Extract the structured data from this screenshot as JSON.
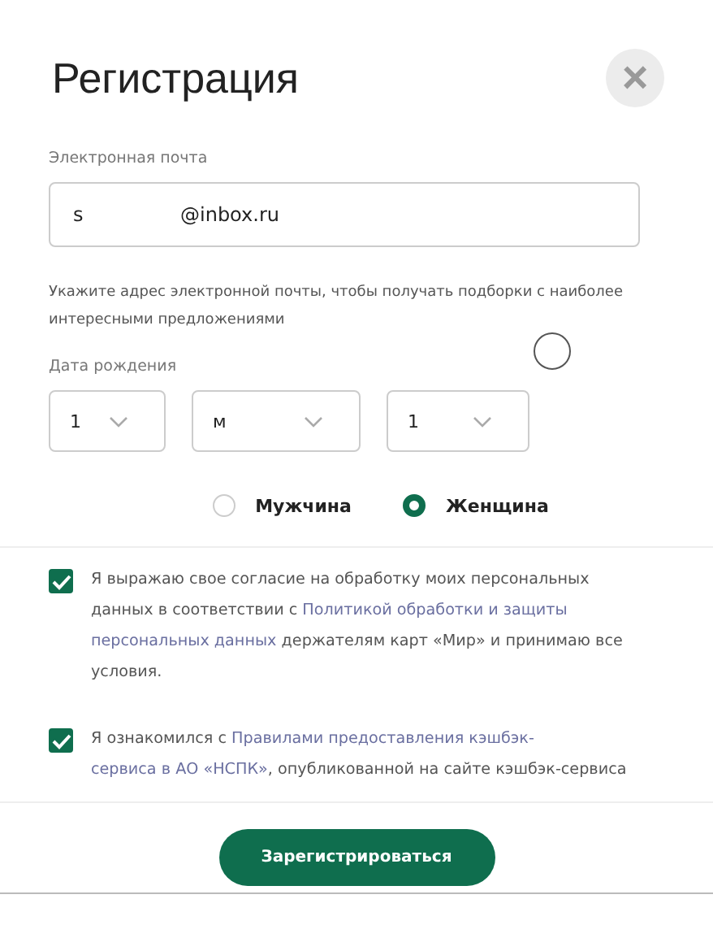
{
  "title": "Регистрация",
  "close": {
    "symbol": "×"
  },
  "email": {
    "label": "Электронная почта",
    "value_parts": [
      "s",
      "@inbox.ru"
    ],
    "hint": "Укажите адрес электронной почты, чтобы получать подборки с наиболее интересными предложениями"
  },
  "birth_date": {
    "label": "Дата рождения",
    "selects": [
      {
        "value": "1"
      },
      {
        "value": "м"
      },
      {
        "value": "1"
      }
    ]
  },
  "gender": [
    {
      "label": "Мужчина",
      "selected": false
    },
    {
      "label": "Женщина",
      "selected": true
    }
  ],
  "consents": [
    {
      "checked": true,
      "parts": [
        {
          "kind": "text",
          "text": "Я выражаю свое согласие на обработку моих персональных данных в соответствии с "
        },
        {
          "kind": "link",
          "text": "Политикой обработки и защиты"
        },
        {
          "kind": "link",
          "text": "персональных данных"
        },
        {
          "kind": "text",
          "text": " держателям карт «Мир» и принимаю все условия."
        }
      ]
    },
    {
      "checked": true,
      "parts": [
        {
          "kind": "text",
          "text": "Я ознакомился с "
        },
        {
          "kind": "link",
          "text": "Правилами предоставления кэшбэк-"
        },
        {
          "kind": "link",
          "text": "сервиса в АО «НСПК»"
        },
        {
          "kind": "text",
          "text": ", опубликованной на сайте кэшбэк-сервиса"
        }
      ]
    }
  ],
  "submit": "Зарегистрироваться"
}
